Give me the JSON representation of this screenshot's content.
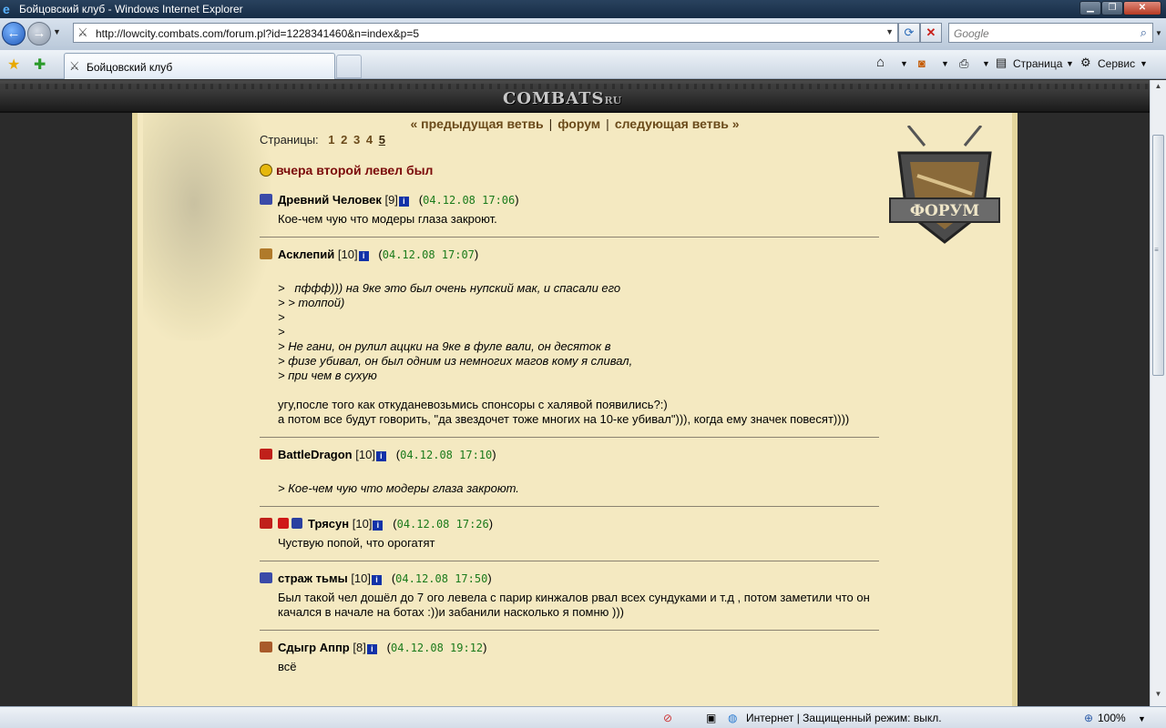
{
  "window": {
    "title": "Бойцовский клуб - Windows Internet Explorer"
  },
  "nav": {
    "url": "http://lowcity.combats.com/forum.pl?id=1228341460&n=index&p=5",
    "search_placeholder": "Google"
  },
  "tab": {
    "title": "Бойцовский клуб"
  },
  "toolbar": {
    "page_label": "Страница",
    "service_label": "Сервис"
  },
  "site": {
    "logo": "COMBATS",
    "logo_suffix": "RU",
    "emblem_text": "ФОРУМ"
  },
  "pager": {
    "prev": "« предыдущая ветвь",
    "sep": "|",
    "forum": "форум",
    "next": "следующая ветвь »"
  },
  "pages": {
    "label": "Страницы:",
    "items": [
      "1",
      "2",
      "3",
      "4",
      "5"
    ],
    "current": "5"
  },
  "thread": {
    "title": "вчера второй левел был"
  },
  "posts": [
    {
      "nick": "Древний Человек",
      "level": "[9]",
      "date": "04.12.08 17:06",
      "body": "Кое-чем чую что модеры глаза закроют.",
      "quote": ""
    },
    {
      "nick": "Асклепий",
      "level": "[10]",
      "date": "04.12.08 17:07",
      "quote": ">   пффф))) на 9ке это был очень нупский мак, и спасали его\n> > толпой)\n>\n>\n> Не гани, он рулил аццки на 9ке в фуле вали, он десяток в\n> физе убивал, он был одним из немногих магов кому я сливал,\n> при чем в сухую",
      "body": "угу,после того как откуданевозьмись спонсоры с халявой появились?:)\nа потом все будут говорить, \"да звездочет тоже многих на 10-ке убивал\"))), когда ему значек повесят))))"
    },
    {
      "nick": "BattleDragon",
      "level": "[10]",
      "date": "04.12.08 17:10",
      "quote": "> Кое-чем чую что модеры глаза закроют.",
      "body": ""
    },
    {
      "nick": "Трясун",
      "level": "[10]",
      "date": "04.12.08 17:26",
      "body": "Чуствую попой, что орогатят",
      "quote": ""
    },
    {
      "nick": "страж тьмы",
      "level": "[10]",
      "date": "04.12.08 17:50",
      "body": "Был такой чел дошёл до 7 ого левела с парир кинжалов рвал всех сундуками и т.д , потом заметили что он качался в начале на ботах :))и забанили насколько я помню )))",
      "quote": ""
    },
    {
      "nick": "Сдыгр Аппр",
      "level": "[8]",
      "date": "04.12.08 19:12",
      "body": "всё",
      "quote": ""
    }
  ],
  "status": {
    "zone": "Интернет | Защищенный режим: выкл.",
    "zoom": "100%"
  }
}
